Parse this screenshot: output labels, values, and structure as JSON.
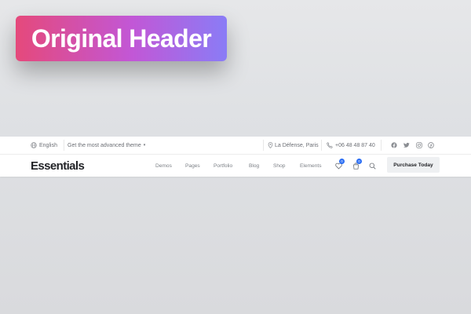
{
  "badge": {
    "title": "Original Header"
  },
  "topbar": {
    "language": "English",
    "tagline": "Get the most advanced theme",
    "location": "La Défense, Paris",
    "phone": "+06 48 48 87 40",
    "social": [
      "facebook-icon",
      "twitter-icon",
      "instagram-icon",
      "pinterest-icon"
    ]
  },
  "header": {
    "logo": "Essentials",
    "nav": [
      "Demos",
      "Pages",
      "Portfolio",
      "Blog",
      "Shop",
      "Elements"
    ],
    "wishlist_count": "0",
    "cart_count": "0",
    "cta": "Purchase Today"
  },
  "colors": {
    "badge_start": "#e5497b",
    "badge_end": "#8a7cf6",
    "count_badge": "#2a6df4"
  }
}
